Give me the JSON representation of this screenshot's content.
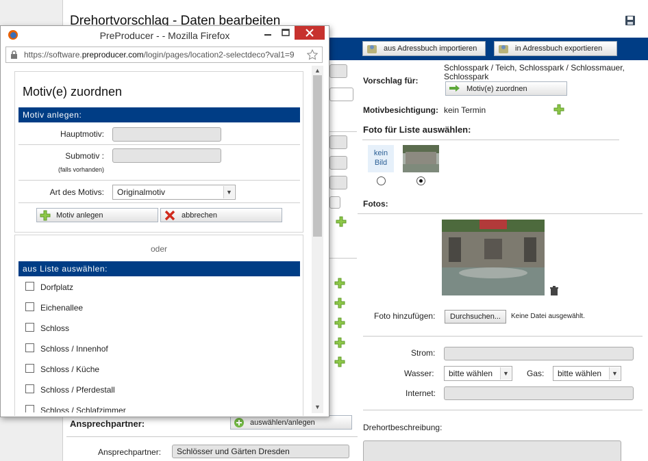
{
  "background_page": {
    "title": "Drehortvorschlag - Daten bearbeiten",
    "import_button": "aus Adressbuch importieren",
    "export_button": "in Adressbuch exportieren",
    "vorschlag_label": "Vorschlag für:",
    "vorschlag_value": "Schlosspark / Teich, Schlosspark / Schlossmauer, Schlosspark",
    "motiv_zuordnen_button": "Motiv(e) zuordnen",
    "motivbesichtigung_label": "Motivbesichtigung:",
    "motivbesichtigung_value": "kein Termin",
    "foto_liste_label": "Foto für Liste auswählen:",
    "kein_bild": "kein Bild",
    "fotos_label": "Fotos:",
    "foto_hinzufuegen_label": "Foto hinzufügen:",
    "durchsuchen_button": "Durchsuchen...",
    "keine_datei": "Keine Datei ausgewählt.",
    "strom_label": "Strom:",
    "wasser_label": "Wasser:",
    "wasser_value": "bitte wählen",
    "gas_label": "Gas:",
    "gas_value": "bitte wählen",
    "internet_label": "Internet:",
    "ansprechpartner_heading": "Ansprechpartner:",
    "auswaehlen_button": "auswählen/anlegen",
    "ansprechpartner_label": "Ansprechpartner:",
    "ansprechpartner_value": "Schlösser und Gärten Dresden",
    "drehortbeschreibung_label": "Drehortbeschreibung:"
  },
  "popup": {
    "window_title": "PreProducer - - Mozilla Firefox",
    "url_prefix": "https://software.",
    "url_domain": "preproducer.com",
    "url_rest": "/login/pages/location2-selectdeco?val1=9",
    "heading": "Motiv(e) zuordnen",
    "motiv_anlegen_header": "Motiv anlegen:",
    "hauptmotiv_label": "Hauptmotiv:",
    "submotiv_label": "Submotiv :",
    "submotiv_hint": "(falls vorhanden)",
    "art_label": "Art des Motivs:",
    "art_value": "Originalmotiv",
    "anlegen_button": "Motiv anlegen",
    "abbrechen_button": "abbrechen",
    "oder": "oder",
    "liste_header": "aus Liste auswählen:",
    "list_items": [
      "Dorfplatz",
      "Eichenallee",
      "Schloss",
      "Schloss / Innenhof",
      "Schloss / Küche",
      "Schloss / Pferdestall",
      "Schloss / Schlafzimmer"
    ]
  }
}
